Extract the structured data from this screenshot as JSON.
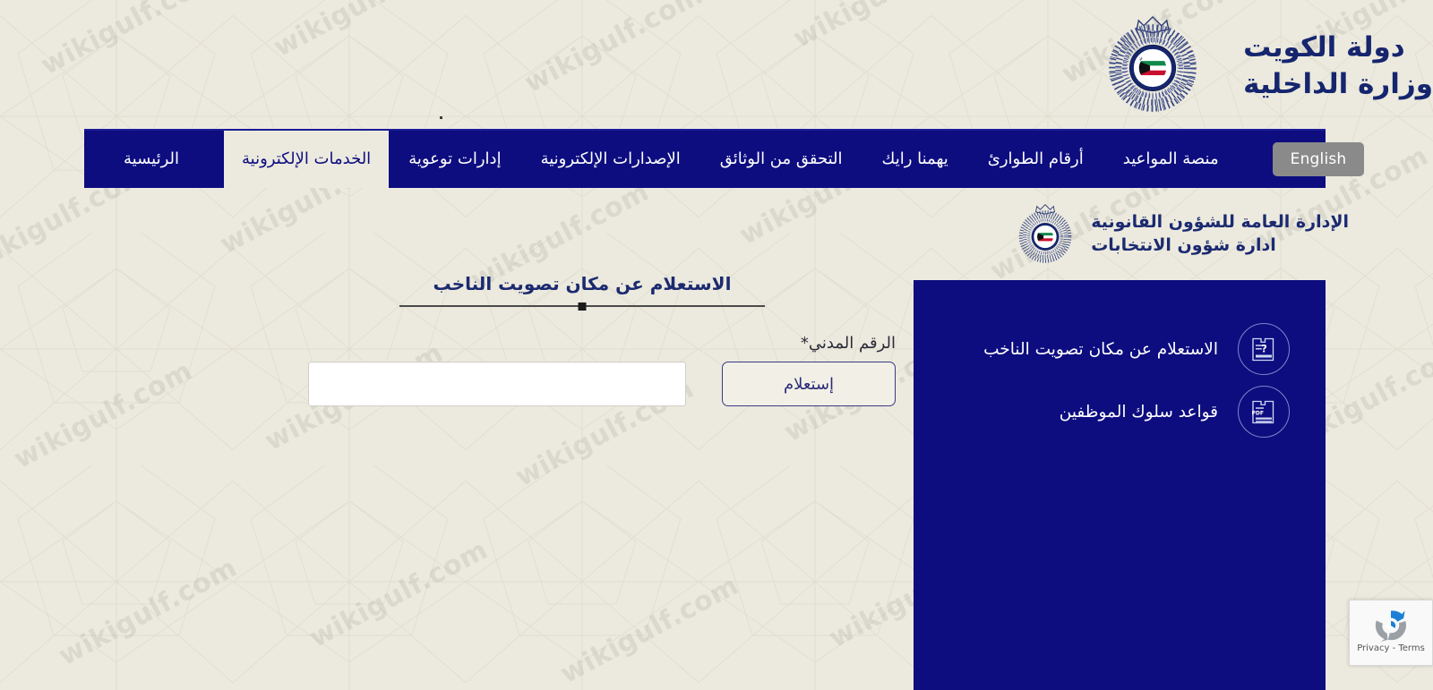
{
  "header": {
    "brand_line1": "دولة الكويت",
    "brand_line2": "وزارة الداخلية",
    "crest_icon": "kuwait-police-crest-icon"
  },
  "nav": {
    "items": [
      {
        "label": "الرئيسية",
        "active": false
      },
      {
        "label": "الخدمات الإلكترونية",
        "active": true
      },
      {
        "label": "إدارات توعوية",
        "active": false
      },
      {
        "label": "الإصدارات الإلكترونية",
        "active": false
      },
      {
        "label": "التحقق من الوثائق",
        "active": false
      },
      {
        "label": "يهمنا رايك",
        "active": false
      },
      {
        "label": "أرقام الطوارئ",
        "active": false
      },
      {
        "label": "منصة المواعيد",
        "active": false
      }
    ],
    "language_button": "English"
  },
  "department": {
    "line1": "الإدارة العامة للشؤون القانونية",
    "line2": "ادارة شؤون الانتخابات",
    "crest_icon": "kuwait-police-crest-icon"
  },
  "form": {
    "title": "الاستعلام عن مكان تصويت الناخب",
    "civil_id_label": "الرقم المدني*",
    "civil_id_value": "",
    "civil_id_placeholder": "",
    "submit_label": "إستعلام"
  },
  "service_panel": {
    "items": [
      {
        "label": "الاستعلام عن مكان تصويت الناخب",
        "icon": "document-question-icon"
      },
      {
        "label": "قواعد سلوك الموظفين",
        "icon": "document-pdf-icon"
      }
    ]
  },
  "recaptcha": {
    "text": "Privacy - Terms",
    "icon": "recaptcha-icon"
  },
  "watermark": {
    "text": "wikigulf.com"
  },
  "colors": {
    "navy": "#0d0d80",
    "page_bg": "#eceade",
    "heading_navy": "#1b2a70",
    "lang_button_bg": "#8a8a8a"
  }
}
